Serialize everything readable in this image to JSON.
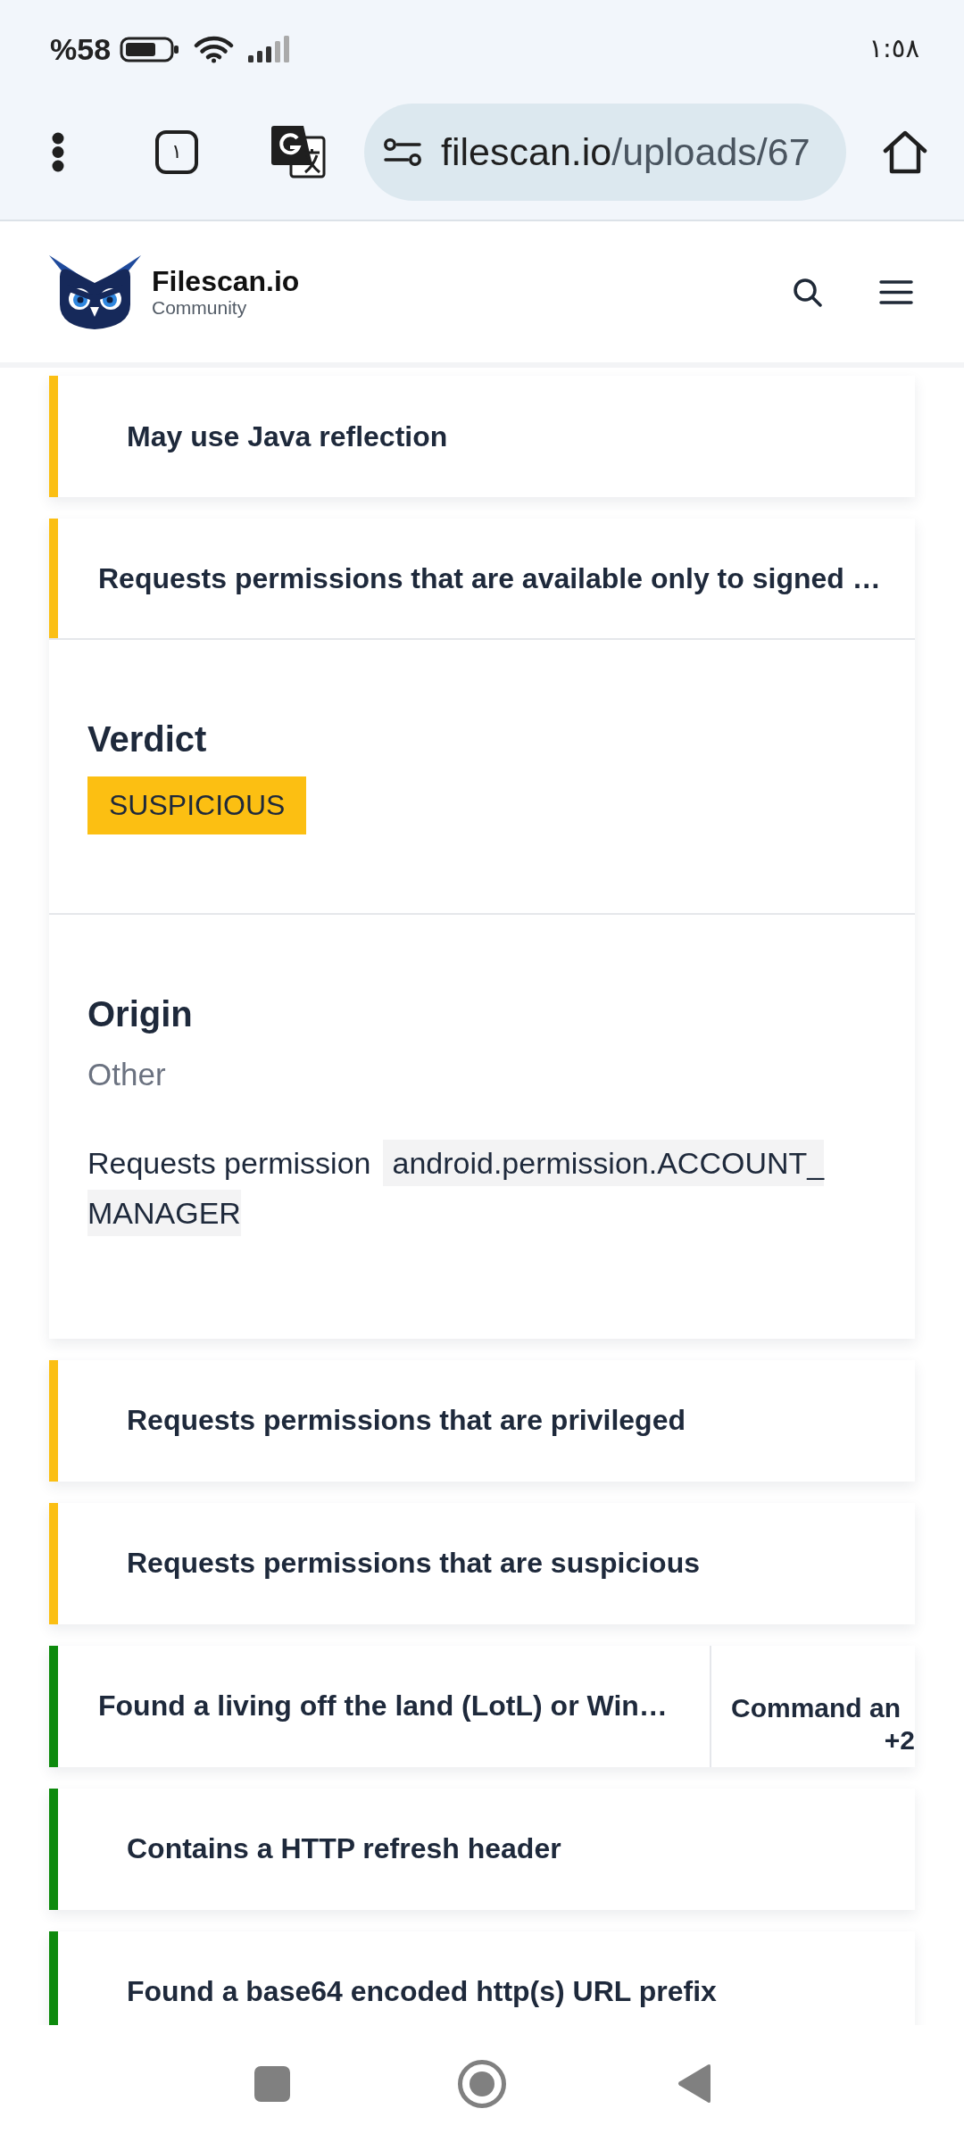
{
  "status_bar": {
    "battery": "%58",
    "time": "١:٥٨"
  },
  "browser_toolbar": {
    "tab_count": "١",
    "url": {
      "host": "filescan.io",
      "path": "/uploads/67"
    }
  },
  "site_header": {
    "brand": "Filescan.io",
    "edition": "Community"
  },
  "findings": [
    {
      "title": "May use Java reflection",
      "color": "#fbbf13",
      "expanded": false
    },
    {
      "title": "Requests permissions that are available only to signed …",
      "color": "#fbbf13",
      "expanded": true,
      "sections": [
        {
          "kind": "badge",
          "heading": "Verdict",
          "badge": "SUSPICIOUS"
        },
        {
          "kind": "description",
          "heading": "Origin",
          "value": "Other",
          "text": "Requests permission",
          "code": "android.permission.ACCOUNT_MANAGER"
        }
      ]
    },
    {
      "title": "Requests permissions that are privileged",
      "color": "#fbbf13",
      "expanded": false
    },
    {
      "title": "Requests permissions that are suspicious",
      "color": "#fbbf13",
      "expanded": false
    },
    {
      "title": "Found a living off the land (LotL) or Win…",
      "color": "#0d8a0d",
      "expanded": false,
      "tag": "Command an",
      "more": "+2"
    },
    {
      "title": "Contains a HTTP refresh header",
      "color": "#0d8a0d",
      "expanded": false
    },
    {
      "title": "Found a base64 encoded http(s) URL prefix",
      "color": "#0d8a0d",
      "expanded": false
    }
  ]
}
